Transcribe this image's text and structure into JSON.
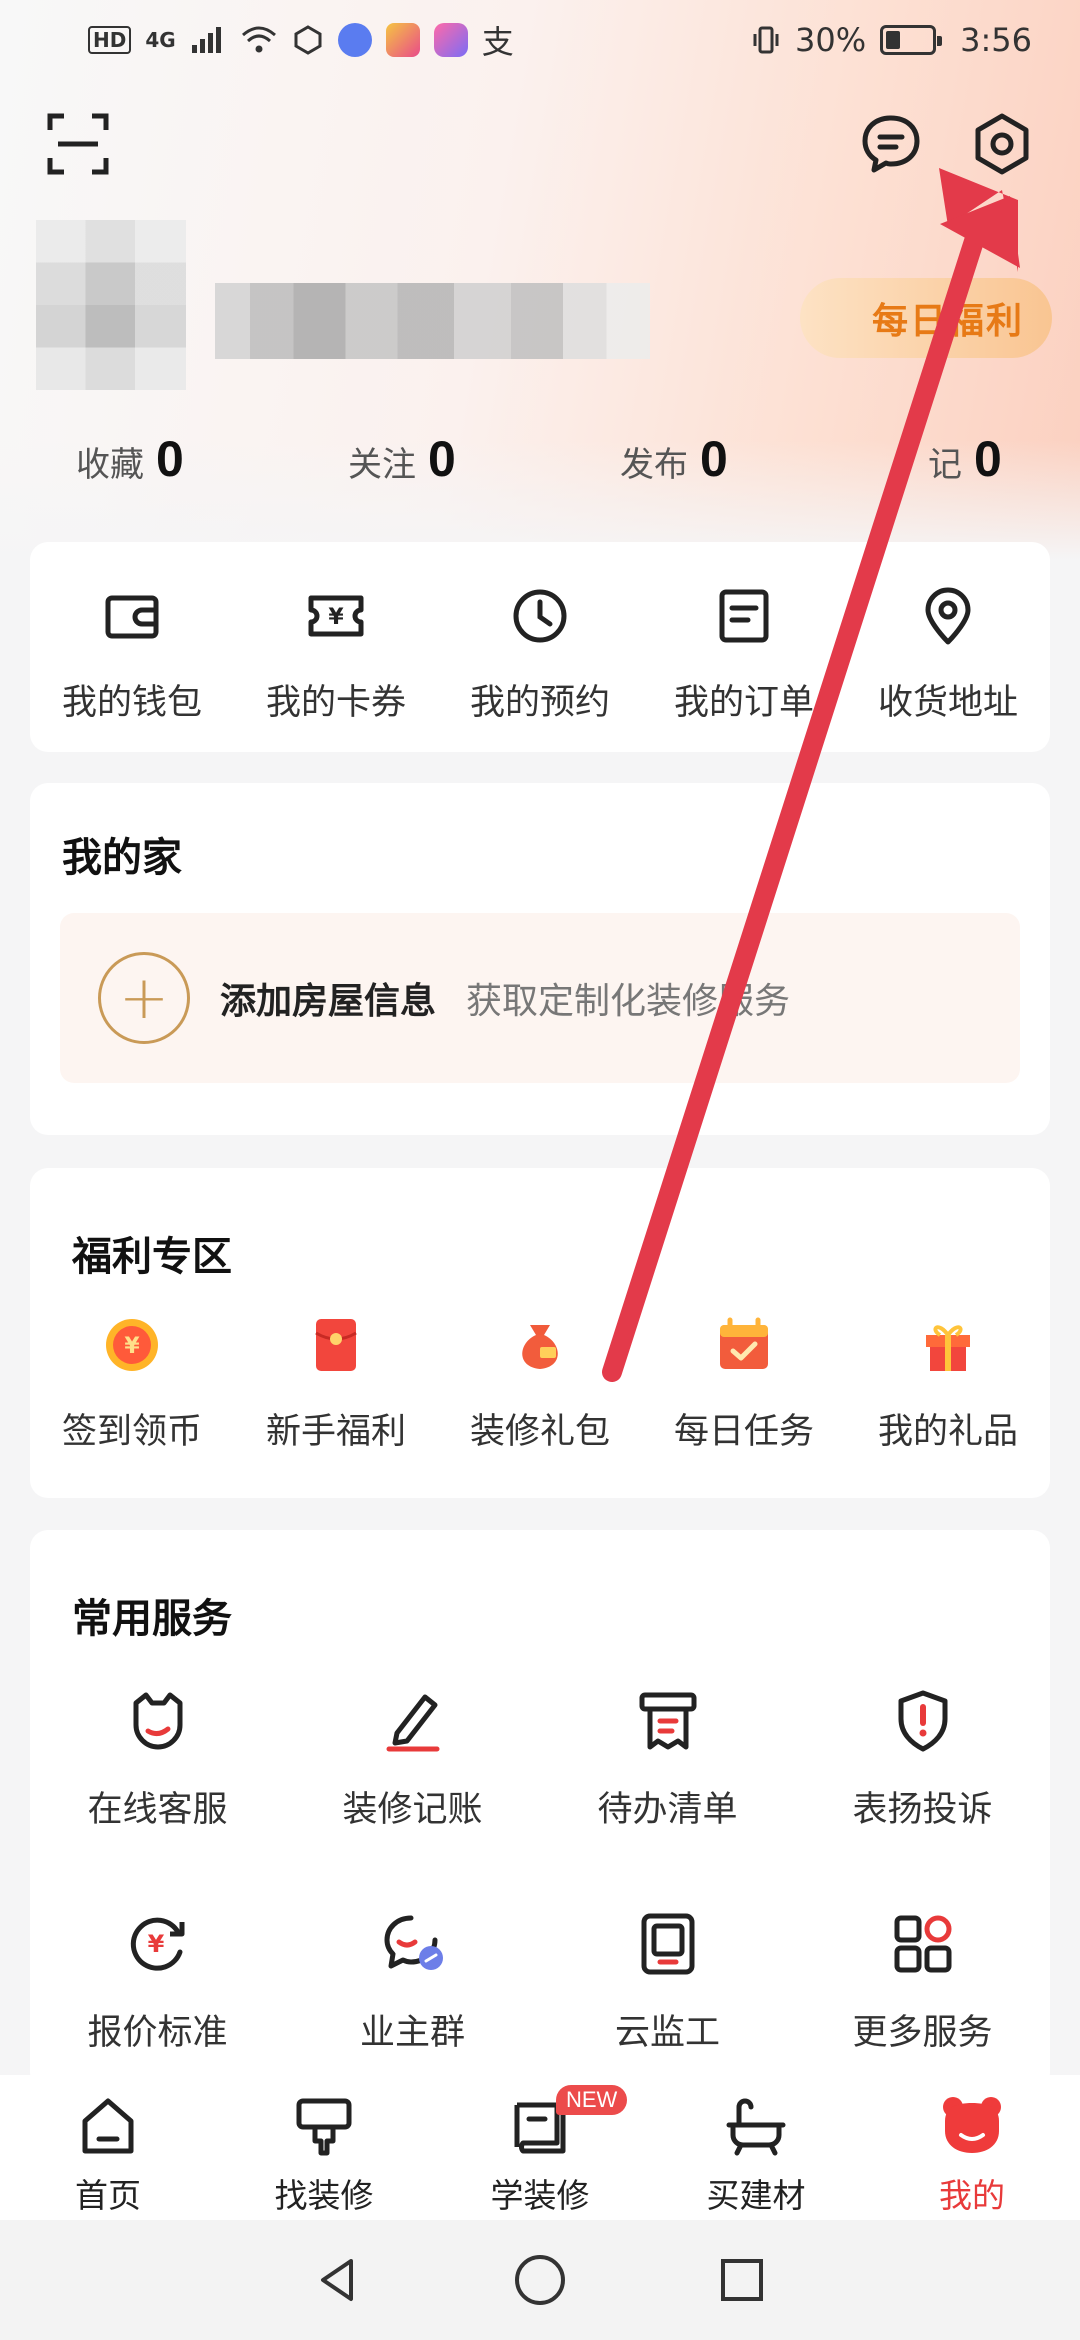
{
  "status": {
    "badge": "HD",
    "net": "4G",
    "battery_text": "30%",
    "time": "3:56"
  },
  "header": {
    "welfare_label": "每日福利"
  },
  "stats": [
    {
      "label": "收藏",
      "value": "0"
    },
    {
      "label": "关注",
      "value": "0"
    },
    {
      "label": "发布",
      "value": "0"
    },
    {
      "label": "记",
      "value": "0"
    }
  ],
  "quick": [
    {
      "label": "我的钱包",
      "icon": "wallet-icon"
    },
    {
      "label": "我的卡券",
      "icon": "coupon-icon"
    },
    {
      "label": "我的预约",
      "icon": "clock-icon"
    },
    {
      "label": "我的订单",
      "icon": "order-icon"
    },
    {
      "label": "收货地址",
      "icon": "location-icon"
    }
  ],
  "home": {
    "title": "我的家",
    "add_title": "添加房屋信息",
    "add_sub": "获取定制化装修服务"
  },
  "welfare": {
    "title": "福利专区",
    "items": [
      {
        "label": "签到领币",
        "icon": "coin-icon"
      },
      {
        "label": "新手福利",
        "icon": "red-envelope-icon"
      },
      {
        "label": "装修礼包",
        "icon": "money-bag-icon"
      },
      {
        "label": "每日任务",
        "icon": "calendar-check-icon"
      },
      {
        "label": "我的礼品",
        "icon": "gift-icon"
      }
    ]
  },
  "services": {
    "title": "常用服务",
    "items": [
      {
        "label": "在线客服",
        "icon": "customer-service-icon"
      },
      {
        "label": "装修记账",
        "icon": "pen-icon"
      },
      {
        "label": "待办清单",
        "icon": "receipt-icon"
      },
      {
        "label": "表扬投诉",
        "icon": "shield-alert-icon"
      },
      {
        "label": "报价标准",
        "icon": "price-refresh-icon"
      },
      {
        "label": "业主群",
        "icon": "chat-group-icon"
      },
      {
        "label": "云监工",
        "icon": "monitor-icon"
      },
      {
        "label": "更多服务",
        "icon": "grid-more-icon"
      }
    ]
  },
  "tabs": [
    {
      "label": "首页",
      "icon": "home-icon"
    },
    {
      "label": "找装修",
      "icon": "paint-brush-icon"
    },
    {
      "label": "学装修",
      "icon": "book-icon",
      "badge": "NEW"
    },
    {
      "label": "买建材",
      "icon": "bathtub-icon"
    },
    {
      "label": "我的",
      "icon": "bear-icon",
      "active": true
    }
  ],
  "colors": {
    "accent": "#e83a3a",
    "welfare_text": "#e77a16",
    "annotation_arrow": "#e33a4a"
  }
}
